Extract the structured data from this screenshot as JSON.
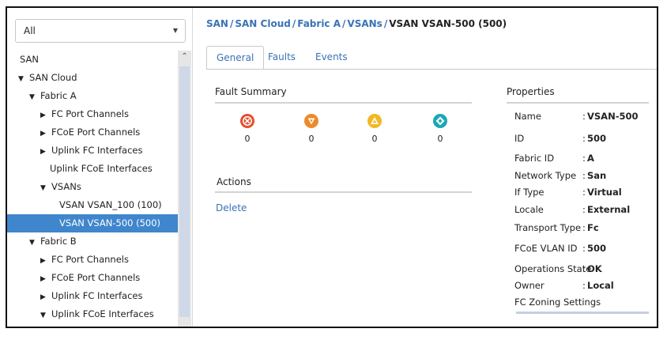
{
  "filter": {
    "selected": "All"
  },
  "tree": [
    {
      "label": "SAN",
      "level": 0,
      "toggle": ""
    },
    {
      "label": "SAN Cloud",
      "level": 1,
      "toggle": "expanded"
    },
    {
      "label": "Fabric A",
      "level": 2,
      "toggle": "expanded"
    },
    {
      "label": "FC Port Channels",
      "level": 3,
      "toggle": "collapsed"
    },
    {
      "label": "FCoE Port Channels",
      "level": 3,
      "toggle": "collapsed"
    },
    {
      "label": "Uplink FC Interfaces",
      "level": 3,
      "toggle": "collapsed"
    },
    {
      "label": "Uplink FCoE Interfaces",
      "level": 3,
      "toggle": ""
    },
    {
      "label": "VSANs",
      "level": 3,
      "toggle": "expanded"
    },
    {
      "label": "VSAN VSAN_100 (100)",
      "level": 4,
      "toggle": ""
    },
    {
      "label": "VSAN VSAN-500 (500)",
      "level": 4,
      "toggle": "",
      "selected": true
    },
    {
      "label": "Fabric B",
      "level": 2,
      "toggle": "expanded"
    },
    {
      "label": "FC Port Channels",
      "level": 3,
      "toggle": "collapsed"
    },
    {
      "label": "FCoE Port Channels",
      "level": 3,
      "toggle": "collapsed"
    },
    {
      "label": "Uplink FC Interfaces",
      "level": 3,
      "toggle": "collapsed"
    },
    {
      "label": "Uplink FCoE Interfaces",
      "level": 3,
      "toggle": "expanded"
    }
  ],
  "breadcrumb": {
    "links": [
      "SAN",
      "SAN Cloud",
      "Fabric A",
      "VSANs"
    ],
    "separator": "/",
    "current": "VSAN VSAN-500 (500)"
  },
  "tabs": [
    {
      "label": "General",
      "active": true
    },
    {
      "label": "Faults",
      "active": false
    },
    {
      "label": "Events",
      "active": false
    }
  ],
  "fault_summary": {
    "title": "Fault Summary",
    "items": [
      {
        "severity": "critical",
        "icon": "critical-fault-icon",
        "color": "#e2502f",
        "count": "0"
      },
      {
        "severity": "major",
        "icon": "major-fault-icon",
        "color": "#ec8a2a",
        "count": "0"
      },
      {
        "severity": "minor",
        "icon": "minor-fault-icon",
        "color": "#f2b824",
        "count": "0"
      },
      {
        "severity": "warning",
        "icon": "warning-fault-icon",
        "color": "#1aa7b5",
        "count": "0"
      }
    ]
  },
  "actions": {
    "title": "Actions",
    "items": [
      "Delete"
    ]
  },
  "properties": {
    "title": "Properties",
    "rows": [
      {
        "key": "Name",
        "value": "VSAN-500"
      },
      {
        "key": "ID",
        "value": "500"
      },
      {
        "key": "Fabric ID",
        "value": "A"
      },
      {
        "key": "Network Type",
        "value": "San"
      },
      {
        "key": "If Type",
        "value": "Virtual"
      },
      {
        "key": "Locale",
        "value": "External"
      },
      {
        "key": "Transport Type",
        "value": "Fc"
      },
      {
        "key": "FCoE VLAN ID",
        "value": "500"
      },
      {
        "key": "Operations State",
        "value": "OK"
      },
      {
        "key": "Owner",
        "value": "Local"
      }
    ],
    "zoning_label": "FC Zoning Settings"
  },
  "colors": {
    "link": "#3a72b5",
    "selection": "#3f86cc"
  }
}
